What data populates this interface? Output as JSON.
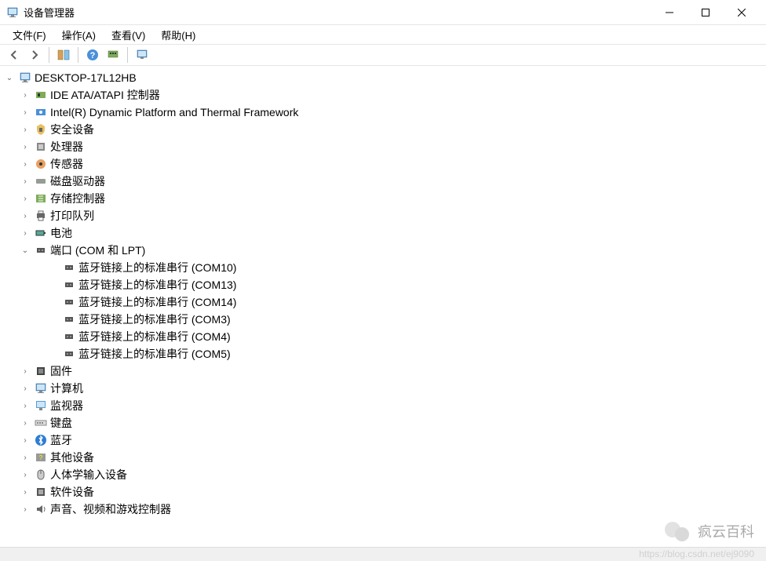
{
  "window": {
    "title": "设备管理器"
  },
  "menu": {
    "file": "文件(F)",
    "action": "操作(A)",
    "view": "查看(V)",
    "help": "帮助(H)"
  },
  "tree": {
    "root": "DESKTOP-17L12HB",
    "categories": [
      {
        "label": "IDE ATA/ATAPI 控制器",
        "expanded": false
      },
      {
        "label": "Intel(R) Dynamic Platform and Thermal Framework",
        "expanded": false
      },
      {
        "label": "安全设备",
        "expanded": false
      },
      {
        "label": "处理器",
        "expanded": false
      },
      {
        "label": "传感器",
        "expanded": false
      },
      {
        "label": "磁盘驱动器",
        "expanded": false
      },
      {
        "label": "存储控制器",
        "expanded": false
      },
      {
        "label": "打印队列",
        "expanded": false
      },
      {
        "label": "电池",
        "expanded": false
      },
      {
        "label": "端口 (COM 和 LPT)",
        "expanded": true
      },
      {
        "label": "固件",
        "expanded": false
      },
      {
        "label": "计算机",
        "expanded": false
      },
      {
        "label": "监视器",
        "expanded": false
      },
      {
        "label": "键盘",
        "expanded": false
      },
      {
        "label": "蓝牙",
        "expanded": false
      },
      {
        "label": "其他设备",
        "expanded": false
      },
      {
        "label": "人体学输入设备",
        "expanded": false
      },
      {
        "label": "软件设备",
        "expanded": false
      },
      {
        "label": "声音、视频和游戏控制器",
        "expanded": false
      }
    ],
    "ports_children": [
      {
        "label": "蓝牙链接上的标准串行 (COM10)"
      },
      {
        "label": "蓝牙链接上的标准串行 (COM13)"
      },
      {
        "label": "蓝牙链接上的标准串行 (COM14)"
      },
      {
        "label": "蓝牙链接上的标准串行 (COM3)"
      },
      {
        "label": "蓝牙链接上的标准串行 (COM4)"
      },
      {
        "label": "蓝牙链接上的标准串行 (COM5)"
      }
    ]
  },
  "watermark": {
    "text": "疯云百科",
    "url": "https://blog.csdn.net/ej9090"
  }
}
